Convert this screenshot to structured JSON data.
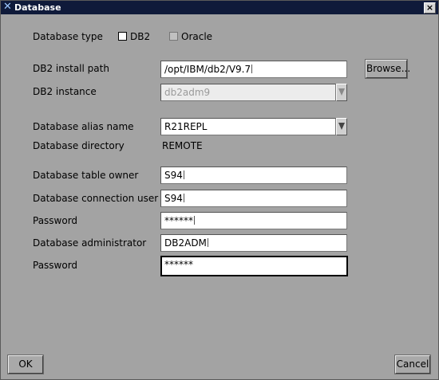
{
  "window": {
    "title": "Database",
    "close_label": "×"
  },
  "form": {
    "database_type_label": "Database type",
    "db2_option": "DB2",
    "oracle_option": "Oracle",
    "install_path_label": "DB2 install path",
    "install_path_value": "/opt/IBM/db2/V9.7",
    "browse_label": "Browse...",
    "instance_label": "DB2 instance",
    "instance_value": "db2adm9",
    "alias_label": "Database alias name",
    "alias_value": "R21REPL",
    "directory_label": "Database directory",
    "directory_value": "REMOTE",
    "table_owner_label": "Database table owner",
    "table_owner_value": "S94",
    "connection_user_label": "Database connection user",
    "connection_user_value": "S94",
    "password1_label": "Password",
    "password1_value": "******",
    "administrator_label": "Database administrator",
    "administrator_value": "DB2ADM",
    "password2_label": "Password",
    "password2_value": "******"
  },
  "footer": {
    "ok_label": "OK",
    "cancel_label": "Cancel"
  }
}
